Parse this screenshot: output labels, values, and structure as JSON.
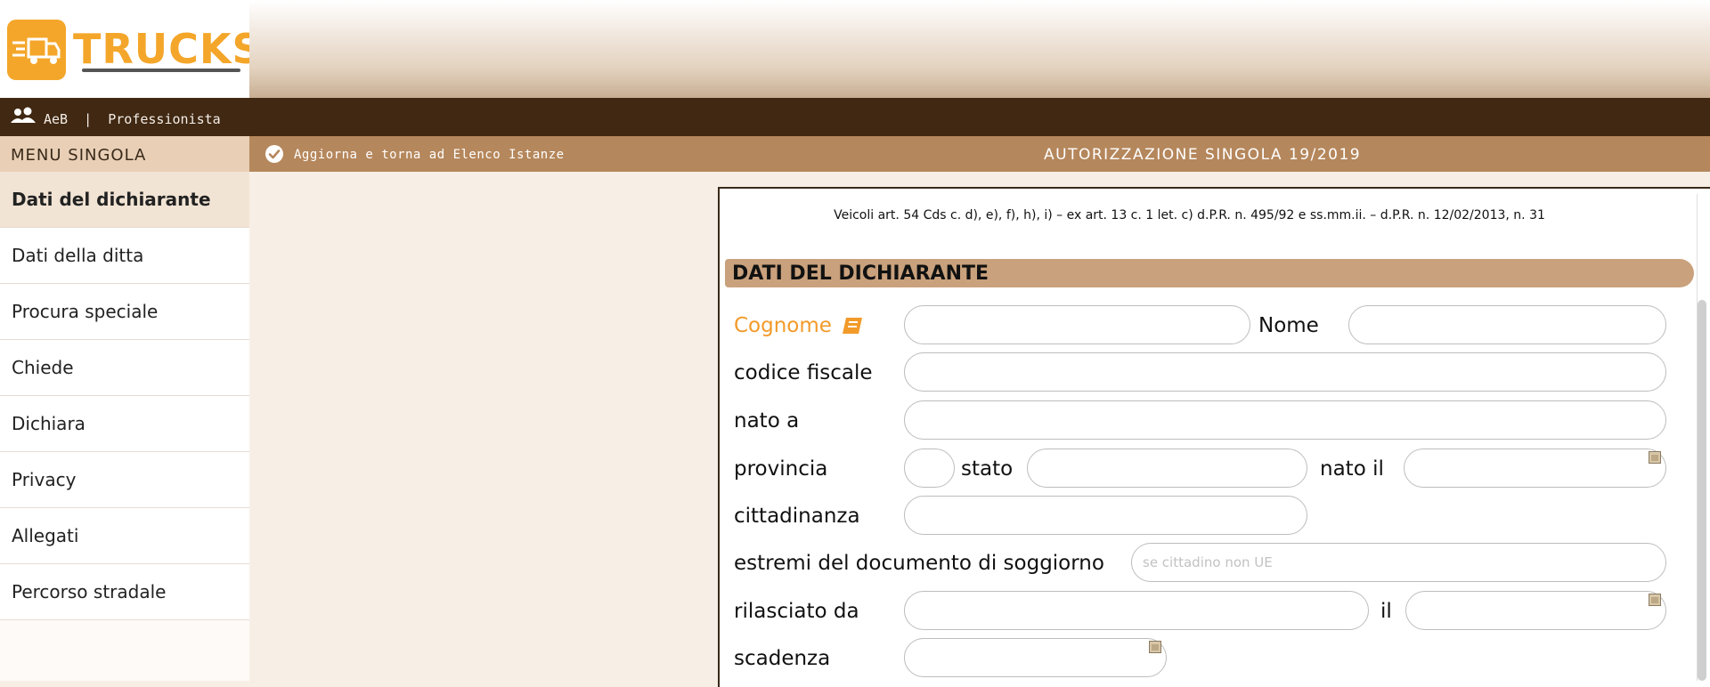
{
  "header": {
    "logo_text": "TRUCKS"
  },
  "userbar": {
    "user_text": "AeB  |  Professionista"
  },
  "menu": {
    "heading": "MENU SINGOLA",
    "items": [
      {
        "label": "Dati del dichiarante",
        "active": true
      },
      {
        "label": "Dati della ditta"
      },
      {
        "label": "Procura speciale"
      },
      {
        "label": "Chiede"
      },
      {
        "label": "Dichiara"
      },
      {
        "label": "Privacy"
      },
      {
        "label": "Allegati"
      },
      {
        "label": "Percorso stradale"
      }
    ]
  },
  "actionbar": {
    "action_label": "Aggiorna e torna ad Elenco Istanze",
    "title": "AUTORIZZAZIONE SINGOLA 19/2019"
  },
  "form": {
    "legal_text": "Veicoli art. 54 Cds c. d), e), f), h), i) – ex art. 13 c. 1 let. c) d.P.R. n. 495/92 e ss.mm.ii. – d.P.R. n. 12/02/2013, n. 31",
    "section_title": "DATI DEL DICHIARANTE",
    "labels": {
      "cognome": "Cognome",
      "nome": "Nome",
      "codice_fiscale": "codice fiscale",
      "nato_a": "nato a",
      "provincia": "provincia",
      "stato": "stato",
      "nato_il": "nato il",
      "cittadinanza": "cittadinanza",
      "documento_soggiorno": "estremi del documento di soggiorno",
      "rilasciato_da": "rilasciato da",
      "il": "il",
      "scadenza": "scadenza"
    },
    "placeholders": {
      "documento_soggiorno": "se cittadino non UE"
    },
    "values": {
      "cognome": "",
      "nome": "",
      "codice_fiscale": "",
      "nato_a": "",
      "provincia": "",
      "stato": "",
      "nato_il": "",
      "cittadinanza": "",
      "documento_soggiorno": "",
      "rilasciato_da": "",
      "il": "",
      "scadenza": ""
    }
  },
  "colors": {
    "accent": "#f29a2a",
    "dark_bar": "#402812",
    "action_bar": "#b5875c",
    "section_bar": "#c9a17c"
  },
  "icons": {
    "logo": "truck-logo-icon",
    "user": "users-icon",
    "check": "check-circle-icon",
    "book": "book-icon",
    "calendar": "calendar-icon"
  }
}
